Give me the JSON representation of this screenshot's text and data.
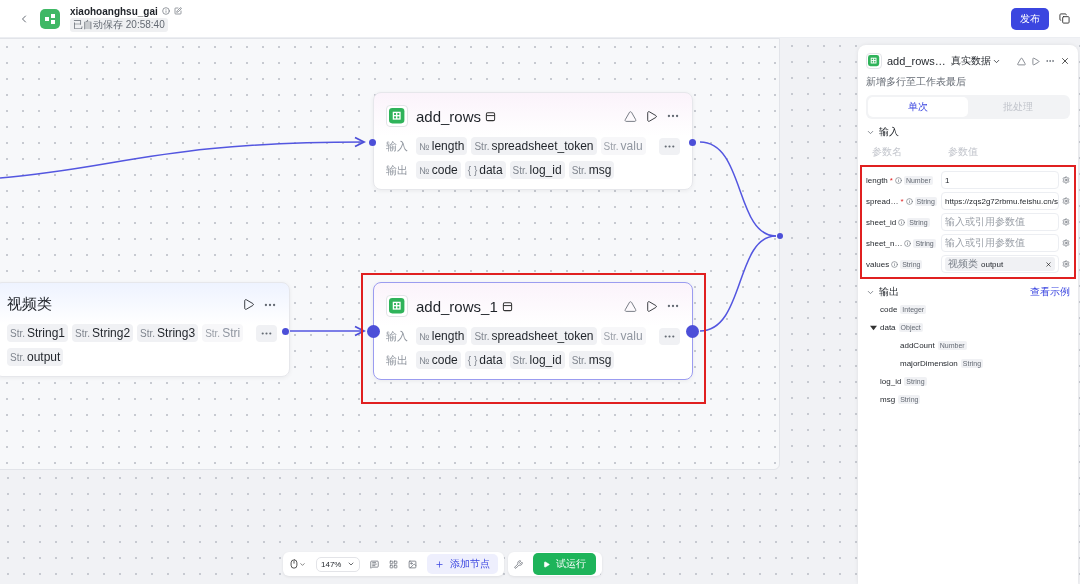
{
  "topbar": {
    "title": "xiaohoanghsu_gai",
    "saved": "已自动保存 20:58:40",
    "publish": "发布"
  },
  "nodes": [
    {
      "kind": "sheet",
      "title": "add_rows",
      "highlighted": false,
      "input_label": "输入",
      "output_label": "输出",
      "inputs": [
        {
          "type": "№",
          "name": "length",
          "faded": false
        },
        {
          "type": "Str.",
          "name": "spreadsheet_token",
          "faded": false
        },
        {
          "type": "Str.",
          "name": "valu",
          "faded": true
        }
      ],
      "outputs": [
        {
          "type": "№",
          "name": "code",
          "faded": false
        },
        {
          "type": "{ }",
          "name": "data",
          "faded": false
        },
        {
          "type": "Str.",
          "name": "log_id",
          "faded": false
        },
        {
          "type": "Str.",
          "name": "msg",
          "faded": false
        }
      ]
    },
    {
      "kind": "text",
      "title": "视频类",
      "highlighted": false,
      "inputs": [
        {
          "type": "Str.",
          "name": "String1",
          "faded": false
        },
        {
          "type": "Str.",
          "name": "String2",
          "faded": false
        },
        {
          "type": "Str.",
          "name": "String3",
          "faded": false
        },
        {
          "type": "Str.",
          "name": "Stri",
          "faded": true
        }
      ],
      "outputs": [
        {
          "type": "Str.",
          "name": "output",
          "faded": false
        }
      ]
    },
    {
      "kind": "sheet",
      "title": "add_rows_1",
      "highlighted": true,
      "input_label": "输入",
      "output_label": "输出",
      "inputs": [
        {
          "type": "№",
          "name": "length",
          "faded": false
        },
        {
          "type": "Str.",
          "name": "spreadsheet_token",
          "faded": false
        },
        {
          "type": "Str.",
          "name": "valu",
          "faded": true
        }
      ],
      "outputs": [
        {
          "type": "№",
          "name": "code",
          "faded": false
        },
        {
          "type": "{ }",
          "name": "data",
          "faded": false
        },
        {
          "type": "Str.",
          "name": "log_id",
          "faded": false
        },
        {
          "type": "Str.",
          "name": "msg",
          "faded": false
        }
      ]
    }
  ],
  "panel": {
    "title": "add_rows…",
    "mode": "真实数据",
    "description": "新增多行至工作表最后",
    "tabs": [
      {
        "label": "单次",
        "selected": true
      },
      {
        "label": "批处理",
        "selected": false
      }
    ],
    "inputs": {
      "title": "输入",
      "expanded": true,
      "highlighted": true,
      "col_name": "参数名",
      "col_value": "参数值",
      "params": [
        {
          "name": "length",
          "required_mark": "*",
          "type": "Number",
          "kind": "text",
          "value": "1"
        },
        {
          "name": "spread…",
          "required_mark": "*",
          "type": "String",
          "kind": "text",
          "value": "https://zqs2g72rbmu.feishu.cn/s"
        },
        {
          "name": "sheet_id",
          "type": "String",
          "kind": "empty",
          "placeholder": "输入或引用参数值"
        },
        {
          "name": "sheet_n…",
          "type": "String",
          "kind": "empty",
          "placeholder": "输入或引用参数值"
        },
        {
          "name": "values",
          "type": "String",
          "kind": "ref",
          "source": "视频类",
          "value": "output"
        }
      ]
    },
    "outputs": {
      "title": "输出",
      "expanded": true,
      "link": "查看示例",
      "items": [
        {
          "name": "code",
          "type": "Integer"
        },
        {
          "name": "data",
          "type": "Object",
          "expanded": true,
          "children": [
            {
              "name": "addCount",
              "type": "Number"
            },
            {
              "name": "majorDimension",
              "type": "String"
            }
          ]
        },
        {
          "name": "log_id",
          "type": "String"
        },
        {
          "name": "msg",
          "type": "String"
        }
      ]
    }
  },
  "toolbar": {
    "zoom": "147%",
    "add_node": "添加节点",
    "run": "试运行"
  }
}
